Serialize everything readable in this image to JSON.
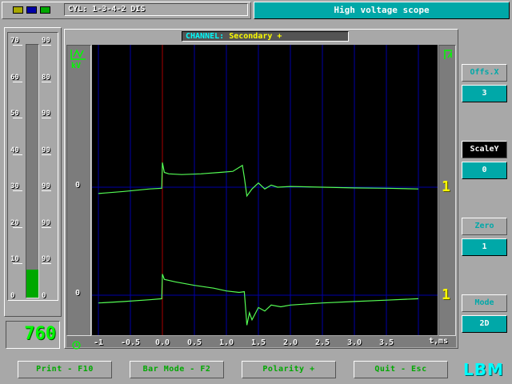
{
  "topbar": {
    "chip_colors": [
      "#a8a800",
      "#0000a8",
      "#00a800"
    ],
    "cyl_label": "CYL:",
    "cyl_value": "1-3-4-2 DIS",
    "app_title": "High voltage scope"
  },
  "left_meter": {
    "scale_left": [
      "70",
      "60",
      "50",
      "40",
      "30",
      "20",
      "10",
      "0"
    ],
    "scale_right": [
      "90",
      "80",
      "90",
      "90",
      "90",
      "90",
      "90",
      "0"
    ],
    "level_fraction": 0.11,
    "rpm_value": "760"
  },
  "scope": {
    "channel_label": "CHANNEL:",
    "channel_value": "Secondary +",
    "y_unit": "kV",
    "zero_labels": [
      "0",
      "0"
    ],
    "right_markers": [
      "1",
      "1"
    ],
    "x_unit": "t,ms"
  },
  "chart_data": {
    "type": "line",
    "xlabel": "t,ms",
    "ylabel": "kV",
    "x_ticks": [
      "-1",
      "-0.5",
      "0.0",
      "0.5",
      "1.0",
      "1.5",
      "2.0",
      "2.5",
      "3.0",
      "3.5"
    ],
    "xlim": [
      -1,
      4
    ],
    "grid": true,
    "series": [
      {
        "x": [
          -1,
          -0.6,
          -0.2,
          -0.01,
          0.0,
          0.03,
          0.1,
          0.3,
          0.6,
          0.9,
          1.1,
          1.25,
          1.28,
          1.32,
          1.4,
          1.5,
          1.6,
          1.7,
          1.8,
          2.0,
          2.5,
          3.0,
          3.5,
          4.0
        ],
        "y": [
          -0.18,
          -0.12,
          -0.05,
          -0.03,
          0.7,
          0.42,
          0.38,
          0.36,
          0.38,
          0.42,
          0.45,
          0.62,
          0.28,
          -0.25,
          -0.05,
          0.12,
          -0.05,
          0.06,
          0.0,
          0.02,
          0.0,
          -0.02,
          -0.03,
          -0.05
        ]
      },
      {
        "x": [
          -1,
          -0.6,
          -0.2,
          -0.01,
          0.0,
          0.03,
          0.2,
          0.5,
          0.8,
          1.0,
          1.2,
          1.28,
          1.32,
          1.36,
          1.4,
          1.5,
          1.6,
          1.7,
          1.85,
          2.0,
          2.5,
          3.0,
          3.5,
          4.0
        ],
        "y": [
          -0.22,
          -0.18,
          -0.13,
          -0.1,
          0.6,
          0.45,
          0.38,
          0.28,
          0.2,
          0.12,
          0.08,
          0.1,
          -0.85,
          -0.5,
          -0.7,
          -0.35,
          -0.45,
          -0.28,
          -0.33,
          -0.28,
          -0.22,
          -0.18,
          -0.14,
          -0.1
        ]
      }
    ]
  },
  "side_controls": {
    "offs_label": "Offs.X",
    "offs_value": "3",
    "scale_label": "ScaleY",
    "scale_value": "0",
    "zero_label": "Zero",
    "zero_value": "1",
    "mode_label": "Mode",
    "mode_value": "2D"
  },
  "bottom": {
    "print_label": "Print - F10",
    "barmode_label": "Bar Mode - F2",
    "polarity_label": "Polarity +",
    "quit_label": "Quit - Esc",
    "logo": "LBM"
  }
}
